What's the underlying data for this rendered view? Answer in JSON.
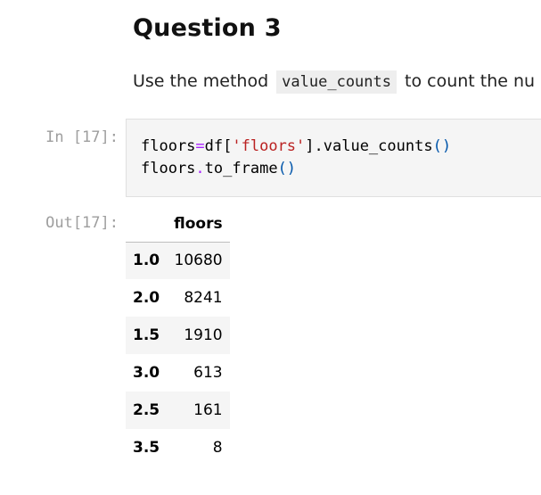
{
  "markdown": {
    "heading": "Question 3",
    "para_before": "Use the method ",
    "inline_code": "value_counts",
    "para_after": " to count the nu"
  },
  "input_cell": {
    "prompt": "In [17]:",
    "line1": {
      "a": "floors",
      "b": "=",
      "c": "df[",
      "d": "'floors'",
      "e": "].value_counts",
      "f": "()"
    },
    "line2": {
      "a": "floors",
      "b": ".",
      "c": "to_frame",
      "d": "()"
    }
  },
  "output_cell": {
    "prompt": "Out[17]:",
    "table": {
      "column_header": "floors",
      "rows": [
        {
          "index": "1.0",
          "value": "10680"
        },
        {
          "index": "2.0",
          "value": "8241"
        },
        {
          "index": "1.5",
          "value": "1910"
        },
        {
          "index": "3.0",
          "value": "613"
        },
        {
          "index": "2.5",
          "value": "161"
        },
        {
          "index": "3.5",
          "value": "8"
        }
      ]
    }
  },
  "colors": {
    "operator": "#aa22ff",
    "string": "#ba2121",
    "paren": "#0055aa",
    "prompt": "#9e9e9e",
    "code_background": "#f5f5f5"
  }
}
